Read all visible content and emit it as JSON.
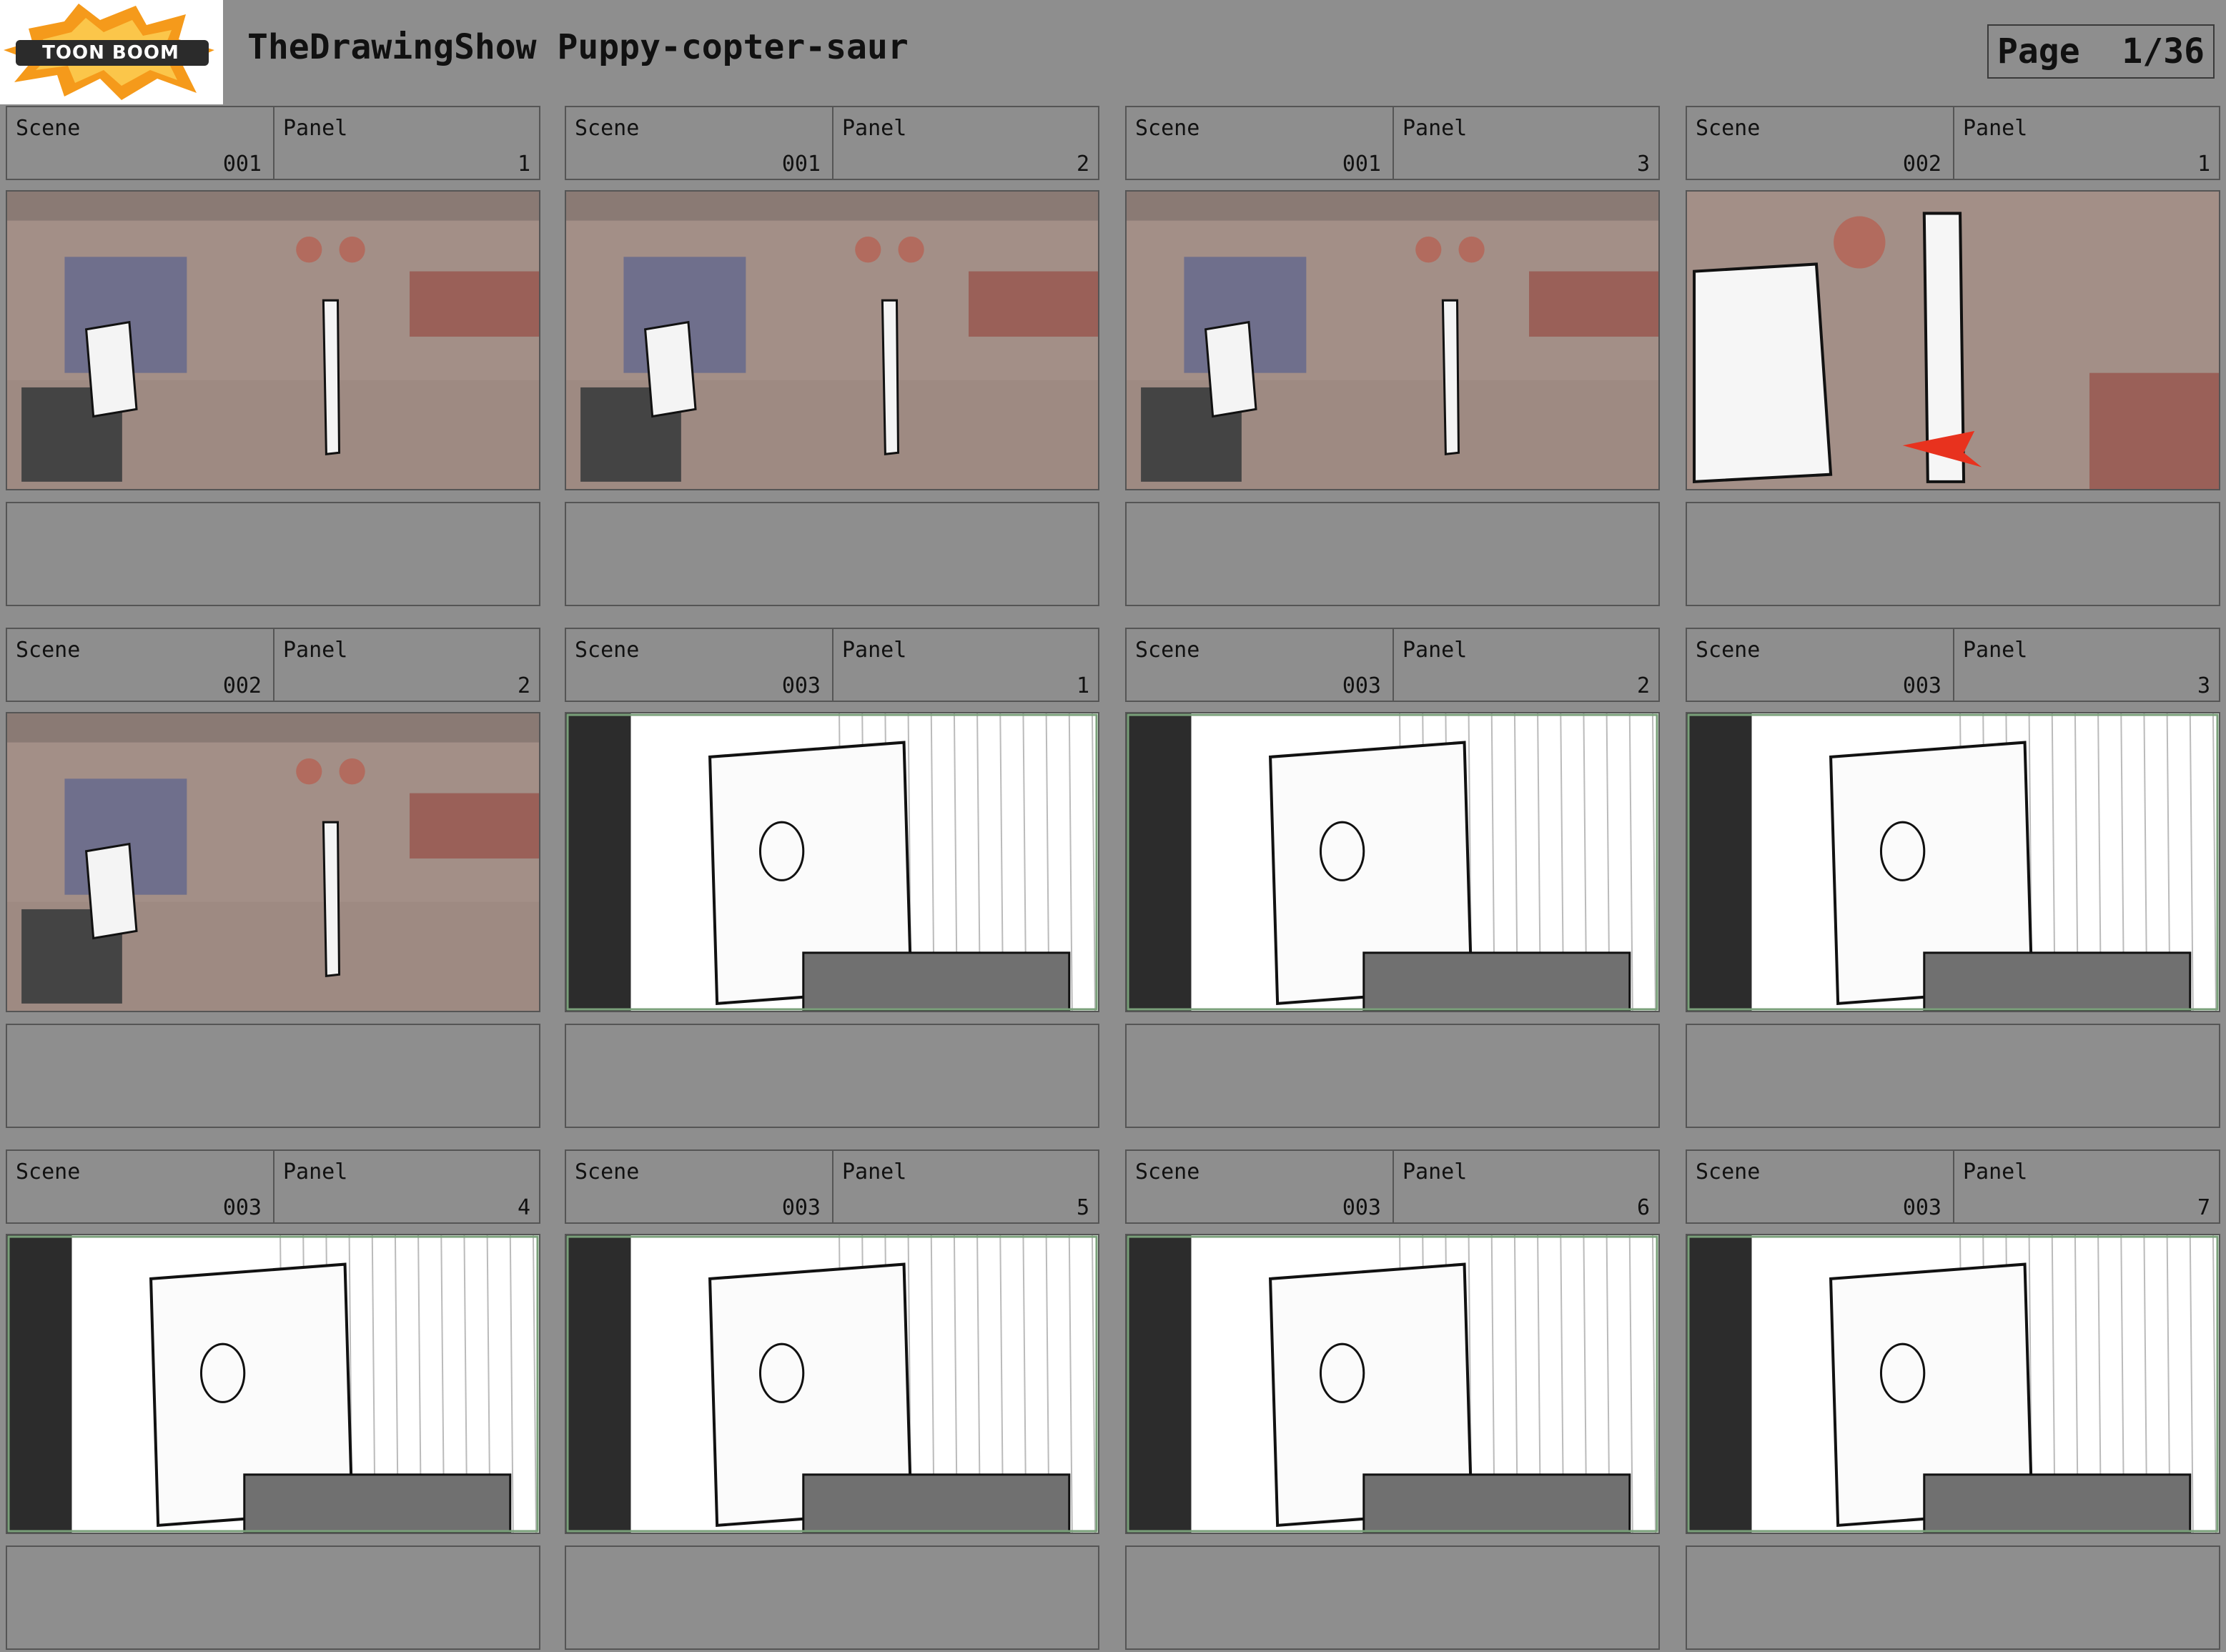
{
  "header": {
    "logo_text": "TOON BOOM",
    "title": "TheDrawingShow Puppy-copter-saur",
    "page_label": "Page",
    "page_value": "1/36"
  },
  "labels": {
    "scene": "Scene",
    "panel": "Panel"
  },
  "colors": {
    "background": "#8e8e8e",
    "logo_orange": "#f59a1b",
    "annotation_red": "#e8321e"
  },
  "panels": [
    {
      "scene": "001",
      "panel": "1",
      "style": "set"
    },
    {
      "scene": "001",
      "panel": "2",
      "style": "set"
    },
    {
      "scene": "001",
      "panel": "3",
      "style": "set"
    },
    {
      "scene": "002",
      "panel": "1",
      "style": "set-close"
    },
    {
      "scene": "002",
      "panel": "2",
      "style": "set"
    },
    {
      "scene": "003",
      "panel": "1",
      "style": "sketch"
    },
    {
      "scene": "003",
      "panel": "2",
      "style": "sketch"
    },
    {
      "scene": "003",
      "panel": "3",
      "style": "sketch"
    },
    {
      "scene": "003",
      "panel": "4",
      "style": "sketch"
    },
    {
      "scene": "003",
      "panel": "5",
      "style": "sketch"
    },
    {
      "scene": "003",
      "panel": "6",
      "style": "sketch"
    },
    {
      "scene": "003",
      "panel": "7",
      "style": "sketch"
    }
  ]
}
